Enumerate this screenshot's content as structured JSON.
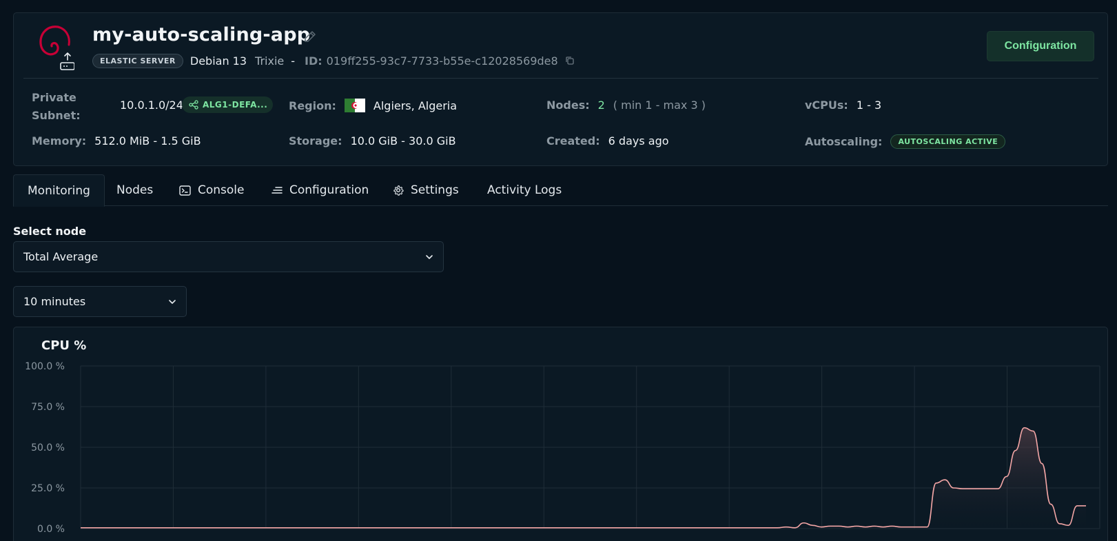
{
  "app": {
    "name": "my-auto-scaling-app",
    "type_badge": "ELASTIC SERVER",
    "os_name": "Debian 13",
    "os_codename": "Trixie",
    "separator": "-",
    "id_label": "ID:",
    "id_value": "019ff255-93c7-7733-b55e-c12028569de8",
    "configuration_button": "Configuration"
  },
  "info": {
    "private_subnet_label": "Private Subnet:",
    "private_subnet_value": "10.0.1.0/24",
    "vpc_tag": "ALG1-DEFA...",
    "region_label": "Region:",
    "region_value": "Algiers, Algeria",
    "nodes_label": "Nodes:",
    "nodes_value": "2",
    "nodes_range": "( min 1 - max 3 )",
    "vcpus_label": "vCPUs:",
    "vcpus_value": "1 - 3",
    "memory_label": "Memory:",
    "memory_value": "512.0 MiB - 1.5 GiB",
    "storage_label": "Storage:",
    "storage_value": "10.0 GiB - 30.0 GiB",
    "created_label": "Created:",
    "created_value": "6 days ago",
    "autoscaling_label": "Autoscaling:",
    "autoscaling_badge": "AUTOSCALING ACTIVE"
  },
  "tabs": [
    {
      "label": "Monitoring",
      "icon": null,
      "active": true
    },
    {
      "label": "Nodes",
      "icon": null,
      "active": false
    },
    {
      "label": "Console",
      "icon": "terminal-icon",
      "active": false
    },
    {
      "label": "Configuration",
      "icon": "lines-icon",
      "active": false
    },
    {
      "label": "Settings",
      "icon": "gear-icon",
      "active": false
    },
    {
      "label": "Activity Logs",
      "icon": null,
      "active": false
    }
  ],
  "monitoring": {
    "select_node_label": "Select node",
    "node_selected": "Total Average",
    "range_selected": "10 minutes"
  },
  "colors": {
    "accent_green": "#7ee6a2",
    "chart_line": "#f4a6a6",
    "debian_red": "#c70036"
  },
  "chart_data": {
    "type": "area",
    "title": "CPU %",
    "ylim": [
      0,
      100
    ],
    "y_ticks": [
      "100.0 %",
      "75.0 %",
      "50.0 %",
      "25.0 %",
      "0.0 %"
    ],
    "grid": true,
    "series": [
      {
        "values": [
          0.5,
          0.5,
          0.5,
          0.5,
          0.5,
          0.5,
          0.5,
          0.5,
          0.5,
          0.5,
          0.5,
          0.5,
          0.5,
          0.5,
          0.5,
          0.5,
          0.5,
          0.5,
          0.5,
          0.5,
          0.5,
          0.5,
          0.5,
          0.5,
          0.5,
          0.5,
          0.5,
          0.5,
          0.5,
          0.5,
          0.5,
          0.5,
          0.5,
          0.5,
          0.5,
          0.5,
          0.5,
          0.5,
          0.5,
          0.5,
          0.5,
          0.5,
          0.5,
          0.5,
          0.5,
          0.5,
          0.5,
          0.5,
          0.5,
          0.5,
          0.5,
          0.5,
          0.5,
          0.5,
          0.5,
          0.5,
          0.5,
          0.5,
          0.5,
          0.5,
          0.5,
          0.5,
          0.5,
          0.5,
          0.5,
          0.5,
          0.5,
          0.5,
          0.5,
          0.5,
          0.5,
          0.5,
          0.5,
          0.5,
          0.5,
          0.5,
          0.5,
          0.5,
          0.5,
          0.5,
          1,
          0.5,
          3.5,
          2,
          1,
          1.5,
          1.5,
          1,
          1.5,
          1,
          1.5,
          1,
          1.5,
          1,
          1,
          1,
          1,
          28,
          30,
          25,
          24.5,
          24.5,
          24.5,
          24.5,
          24.5,
          32,
          48,
          62,
          60,
          40,
          15,
          3,
          2,
          14,
          14
        ]
      }
    ]
  }
}
